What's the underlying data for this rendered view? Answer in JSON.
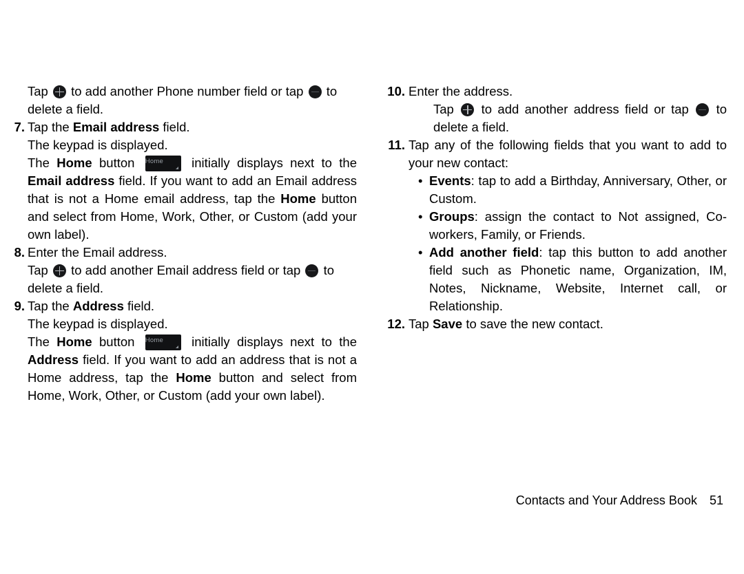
{
  "document": {
    "type": "user-manual-page",
    "page_number": "51",
    "footer_title": "Contacts and Your Address Book",
    "background_color": "#ffffff",
    "text_color": "#000000"
  },
  "icons": {
    "add_field": "plus-circle-icon",
    "delete_field": "minus-circle-icon",
    "home_button_label": "Home"
  },
  "left_column": {
    "continuation": {
      "line_a_pre": "Tap ",
      "line_a_mid": " to add another Phone number field or tap ",
      "line_a_post": " to delete a field."
    },
    "step7": {
      "number": "7.",
      "title_pre": "Tap the ",
      "title_bold": "Email address",
      "title_post": " field.",
      "note": "The keypad is displayed.",
      "body_1": "The ",
      "body_bold_1": "Home",
      "body_2": " button ",
      "body_3": " initially displays next to the ",
      "body_bold_2": "Email address",
      "body_4": " field. If you want to add an Email address that is not a Home email address, tap the ",
      "body_bold_3": "Home",
      "body_5": " button and select from Home, Work, Other, or Custom (add your own label)."
    },
    "step8": {
      "number": "8.",
      "title": "Enter the Email address.",
      "sub_pre": "Tap ",
      "sub_mid": " to add another Email address field or tap ",
      "sub_post": " to delete a field."
    },
    "step9": {
      "number": "9.",
      "title_pre": "Tap the ",
      "title_bold": "Address",
      "title_post": " field.",
      "note": "The keypad is displayed.",
      "body_1": "The ",
      "body_bold_1": "Home",
      "body_2": " button ",
      "body_3": " initially displays next to the ",
      "body_bold_2": "Address",
      "body_4": " field. If you want to add an address that is not a Home address, tap the ",
      "body_bold_3": "Home",
      "body_5": " button and select from Home, Work, Other, or Custom (add your own label)."
    }
  },
  "right_column": {
    "step10": {
      "number": "10.",
      "title": "Enter the address.",
      "sub_pre": "Tap ",
      "sub_mid": " to add another address field or tap ",
      "sub_post": " to delete a field."
    },
    "step11": {
      "number": "11.",
      "title": "Tap any of the following fields that you want to add to your new contact:",
      "bullets": [
        {
          "bullet": "•",
          "label": "Events",
          "text": ": tap to add a Birthday, Anniversary, Other, or Custom."
        },
        {
          "bullet": "•",
          "label": "Groups",
          "text": ": assign the contact to Not assigned, Co-workers, Family, or Friends."
        },
        {
          "bullet": "•",
          "label": "Add another field",
          "text": ": tap this button to add another field such as Phonetic name, Organization, IM, Notes, Nickname, Website, Internet call, or Relationship."
        }
      ]
    },
    "step12": {
      "number": "12.",
      "pre": "Tap ",
      "bold": "Save",
      "post": " to save the new contact."
    }
  }
}
